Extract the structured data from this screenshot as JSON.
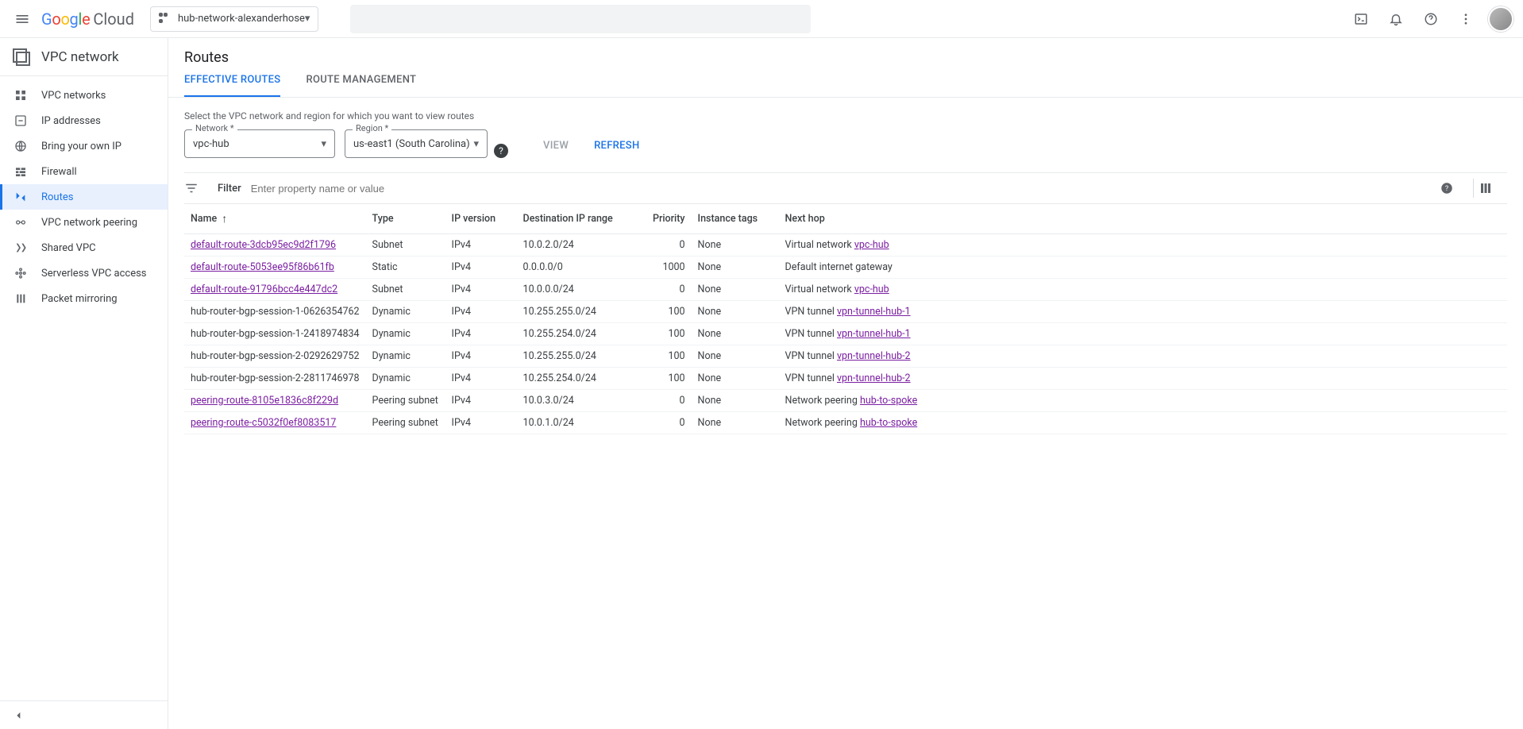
{
  "header": {
    "product_name": "Cloud",
    "project_name": "hub-network-alexanderhose"
  },
  "sidebar": {
    "title": "VPC network",
    "items": [
      {
        "label": "VPC networks",
        "icon": "grid"
      },
      {
        "label": "IP addresses",
        "icon": "ip"
      },
      {
        "label": "Bring your own IP",
        "icon": "globe"
      },
      {
        "label": "Firewall",
        "icon": "firewall"
      },
      {
        "label": "Routes",
        "icon": "routes",
        "active": true
      },
      {
        "label": "VPC network peering",
        "icon": "peering"
      },
      {
        "label": "Shared VPC",
        "icon": "shared"
      },
      {
        "label": "Serverless VPC access",
        "icon": "serverless"
      },
      {
        "label": "Packet mirroring",
        "icon": "mirror"
      }
    ]
  },
  "page": {
    "title": "Routes",
    "tabs": [
      {
        "label": "EFFECTIVE ROUTES",
        "active": true
      },
      {
        "label": "ROUTE MANAGEMENT"
      }
    ],
    "helper_text": "Select the VPC network and region for which you want to view routes",
    "selectors": {
      "network_label": "Network *",
      "network_value": "vpc-hub",
      "region_label": "Region *",
      "region_value": "us-east1 (South Carolina)"
    },
    "buttons": {
      "view": "VIEW",
      "refresh": "REFRESH"
    },
    "filter": {
      "label": "Filter",
      "placeholder": "Enter property name or value"
    },
    "columns": [
      "Name",
      "Type",
      "IP version",
      "Destination IP range",
      "Priority",
      "Instance tags",
      "Next hop"
    ],
    "rows": [
      {
        "name": "default-route-3dcb95ec9d2f1796",
        "link": true,
        "type": "Subnet",
        "ipv": "IPv4",
        "dest": "10.0.2.0/24",
        "prio": "0",
        "tags": "None",
        "nh_prefix": "Virtual network ",
        "nh_link": "vpc-hub"
      },
      {
        "name": "default-route-5053ee95f86b61fb",
        "link": true,
        "type": "Static",
        "ipv": "IPv4",
        "dest": "0.0.0.0/0",
        "prio": "1000",
        "tags": "None",
        "nh_prefix": "Default internet gateway",
        "nh_link": ""
      },
      {
        "name": "default-route-91796bcc4e447dc2",
        "link": true,
        "type": "Subnet",
        "ipv": "IPv4",
        "dest": "10.0.0.0/24",
        "prio": "0",
        "tags": "None",
        "nh_prefix": "Virtual network ",
        "nh_link": "vpc-hub"
      },
      {
        "name": "hub-router-bgp-session-1-0626354762",
        "link": false,
        "type": "Dynamic",
        "ipv": "IPv4",
        "dest": "10.255.255.0/24",
        "prio": "100",
        "tags": "None",
        "nh_prefix": "VPN tunnel ",
        "nh_link": "vpn-tunnel-hub-1"
      },
      {
        "name": "hub-router-bgp-session-1-2418974834",
        "link": false,
        "type": "Dynamic",
        "ipv": "IPv4",
        "dest": "10.255.254.0/24",
        "prio": "100",
        "tags": "None",
        "nh_prefix": "VPN tunnel ",
        "nh_link": "vpn-tunnel-hub-1"
      },
      {
        "name": "hub-router-bgp-session-2-0292629752",
        "link": false,
        "type": "Dynamic",
        "ipv": "IPv4",
        "dest": "10.255.255.0/24",
        "prio": "100",
        "tags": "None",
        "nh_prefix": "VPN tunnel ",
        "nh_link": "vpn-tunnel-hub-2"
      },
      {
        "name": "hub-router-bgp-session-2-2811746978",
        "link": false,
        "type": "Dynamic",
        "ipv": "IPv4",
        "dest": "10.255.254.0/24",
        "prio": "100",
        "tags": "None",
        "nh_prefix": "VPN tunnel ",
        "nh_link": "vpn-tunnel-hub-2"
      },
      {
        "name": "peering-route-8105e1836c8f229d",
        "link": true,
        "type": "Peering subnet",
        "ipv": "IPv4",
        "dest": "10.0.3.0/24",
        "prio": "0",
        "tags": "None",
        "nh_prefix": "Network peering ",
        "nh_link": "hub-to-spoke"
      },
      {
        "name": "peering-route-c5032f0ef8083517",
        "link": true,
        "type": "Peering subnet",
        "ipv": "IPv4",
        "dest": "10.0.1.0/24",
        "prio": "0",
        "tags": "None",
        "nh_prefix": "Network peering ",
        "nh_link": "hub-to-spoke"
      }
    ]
  }
}
